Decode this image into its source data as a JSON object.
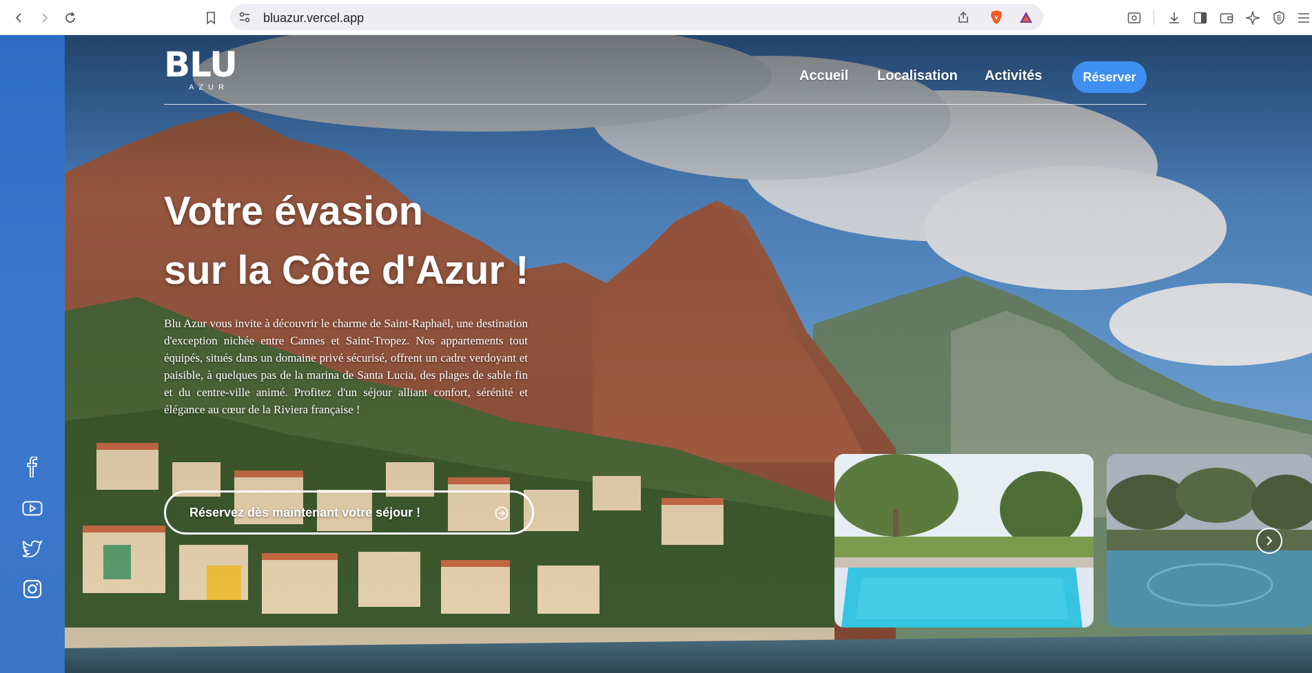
{
  "browser": {
    "url": "bluazur.vercel.app"
  },
  "site": {
    "logo": {
      "main": "BLU",
      "sub": "AZUR"
    },
    "nav": [
      {
        "label": "Accueil"
      },
      {
        "label": "Localisation"
      },
      {
        "label": "Activités"
      }
    ],
    "reserve_label": "Réserver"
  },
  "hero": {
    "title_line1": "Votre évasion",
    "title_line2": "sur la Côte d'Azur !",
    "description": "Blu Azur vous invite à découvrir le charme de Saint-Raphaël, une destination d'exception nichée entre Cannes et Saint-Tropez. Nos appartements tout équipés, situés dans un domaine privé sécurisé, offrent un cadre verdoyant et paisible, à quelques pas de la marina de Santa Lucia, des plages de sable fin et du centre-ville animé. Profitez d'un séjour alliant confort, sérénité et élégance au cœur de la Riviera française !",
    "cta_label": "Réservez dès maintenant votre séjour !"
  },
  "social": [
    "facebook-icon",
    "youtube-icon",
    "twitter-icon",
    "instagram-icon"
  ],
  "colors": {
    "accent": "#3f8ff0",
    "side_strip": "#3570c4"
  }
}
